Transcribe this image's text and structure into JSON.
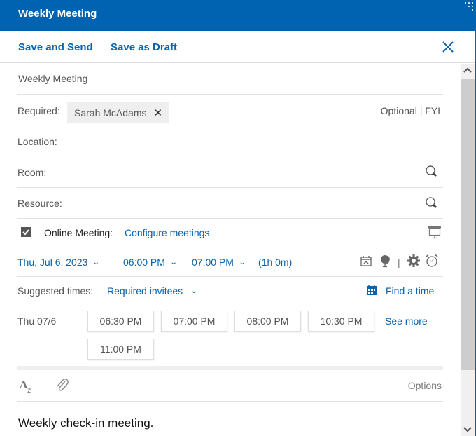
{
  "window": {
    "title": "Weekly Meeting"
  },
  "toolbar": {
    "save_and_send": "Save and Send",
    "save_as_draft": "Save as Draft",
    "close_icon": "close-icon"
  },
  "form": {
    "subject": "Weekly Meeting",
    "required_label": "Required:",
    "required_attendees": [
      {
        "name": "Sarah McAdams",
        "remove_icon": "✕"
      }
    ],
    "optional_fyi": "Optional | FYI",
    "location_label": "Location:",
    "location_value": "",
    "room_label": "Room:",
    "room_value": "",
    "resource_label": "Resource:",
    "resource_value": "",
    "online_meeting": {
      "checked": true,
      "label": "Online Meeting:",
      "configure_link": "Configure meetings"
    },
    "schedule": {
      "date": "Thu, Jul 6, 2023",
      "start_time": "06:00 PM",
      "end_time": "07:00 PM",
      "duration": "(1h 0m)",
      "separator": "|"
    },
    "suggested": {
      "label": "Suggested times:",
      "filter": "Required invitees",
      "find_a_time": "Find a time",
      "day": "Thu 07/6",
      "times": [
        "06:30 PM",
        "07:00 PM",
        "08:00 PM",
        "10:30 PM",
        "11:00 PM"
      ],
      "see_more": "See more"
    }
  },
  "editor": {
    "options_label": "Options",
    "body": "Weekly check-in meeting."
  },
  "icons": {
    "format": "text-format-icon",
    "attach": "paperclip-icon",
    "search": "search-icon",
    "presentation": "presentation-icon",
    "recurrence": "recurrence-icon",
    "timezone": "globe-icon",
    "settings": "gear-icon",
    "reminder": "alarm-clock-icon",
    "calendar": "calendar-icon"
  },
  "colors": {
    "brand": "#0063b1",
    "link": "#0b63ad"
  }
}
